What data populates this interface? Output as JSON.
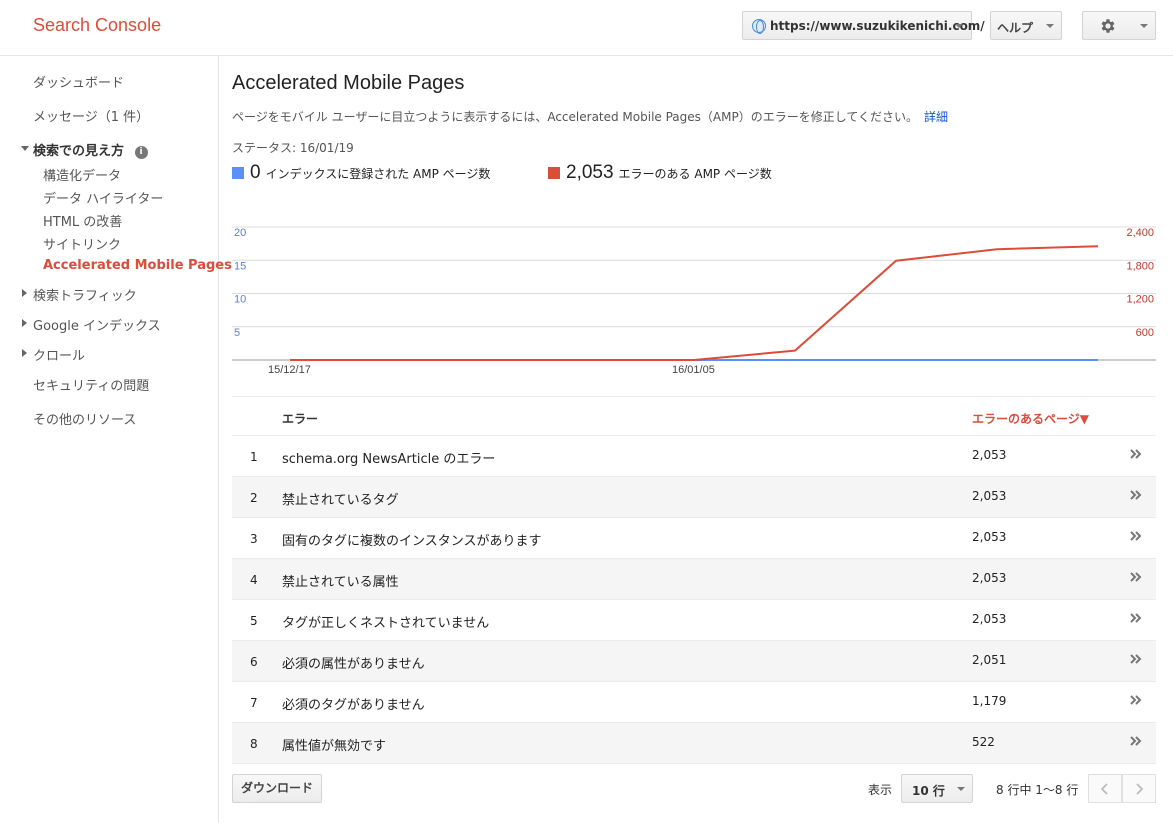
{
  "header": {
    "brand": "Search Console",
    "site_url": "https://www.suzukikenichi.com/",
    "help_label": "ヘルプ"
  },
  "sidebar": {
    "dashboard": "ダッシュボード",
    "messages": "メッセージ（1 件）",
    "search_appearance": "検索での見え方",
    "sub_items": [
      "構造化データ",
      "データ ハイライター",
      "HTML の改善",
      "サイトリンク",
      "Accelerated Mobile Pages"
    ],
    "search_traffic": "検索トラフィック",
    "google_index": "Google インデックス",
    "crawl": "クロール",
    "security": "セキュリティの問題",
    "other_resources": "その他のリソース"
  },
  "main": {
    "title": "Accelerated Mobile Pages",
    "description": "ページをモバイル ユーザーに目立つように表示するには、Accelerated Mobile Pages（AMP）のエラーを修正してください。",
    "details_link": "詳細",
    "status": "ステータス: 16/01/19",
    "legend": [
      {
        "value": "0",
        "label": "インデックスに登録された AMP ページ数",
        "color": "#5b8ff9"
      },
      {
        "value": "2,053",
        "label": "エラーのある AMP ページ数",
        "color": "#dd4b39"
      }
    ]
  },
  "chart_data": {
    "type": "line",
    "x_ticks": [
      "15/12/17",
      "16/01/05"
    ],
    "y_left_ticks": [
      "20",
      "15",
      "10",
      "5"
    ],
    "y_left_range": [
      0,
      20
    ],
    "y_right_ticks": [
      "2,400",
      "1,800",
      "1,200",
      "600"
    ],
    "y_right_range": [
      0,
      2400
    ],
    "series": [
      {
        "name": "インデックスに登録された AMP ページ数",
        "axis": "left",
        "color": "#5b8ff9",
        "values": [
          0,
          0,
          0,
          0,
          0,
          0,
          0,
          0,
          0
        ]
      },
      {
        "name": "エラーのある AMP ページ数",
        "axis": "right",
        "color": "#dd4b39",
        "values": [
          0,
          0,
          0,
          0,
          0,
          170,
          1790,
          2000,
          2053
        ]
      }
    ]
  },
  "table": {
    "col_error": "エラー",
    "col_pages": "エラーのあるページ▼",
    "rows": [
      {
        "idx": "1",
        "error": "schema.org NewsArticle のエラー",
        "count": "2,053"
      },
      {
        "idx": "2",
        "error": "禁止されているタグ",
        "count": "2,053"
      },
      {
        "idx": "3",
        "error": "固有のタグに複数のインスタンスがあります",
        "count": "2,053"
      },
      {
        "idx": "4",
        "error": "禁止されている属性",
        "count": "2,053"
      },
      {
        "idx": "5",
        "error": "タグが正しくネストされていません",
        "count": "2,053"
      },
      {
        "idx": "6",
        "error": "必須の属性がありません",
        "count": "2,051"
      },
      {
        "idx": "7",
        "error": "必須のタグがありません",
        "count": "1,179"
      },
      {
        "idx": "8",
        "error": "属性値が無効です",
        "count": "522"
      }
    ]
  },
  "footer": {
    "download": "ダウンロード",
    "show_label": "表示",
    "rows_per_page": "10 行",
    "range": "8 行中 1〜8 行"
  }
}
